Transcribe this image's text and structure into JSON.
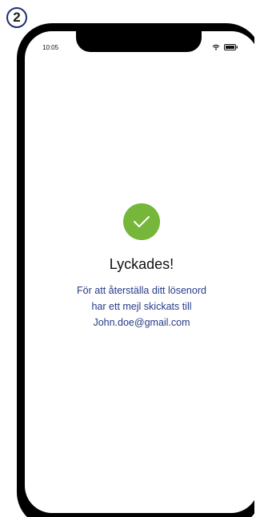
{
  "step": {
    "number": "2"
  },
  "status_bar": {
    "time": "10:05",
    "icons": [
      "wifi-icon",
      "battery-icon"
    ]
  },
  "success": {
    "icon": "check-icon",
    "title": "Lyckades!",
    "message_lines": [
      "För att återställa ditt lösenord",
      "har ett mejl skickats till",
      "John.doe@gmail.com"
    ]
  },
  "colors": {
    "frame": "#000000",
    "success_green": "#76b63a",
    "message_blue": "#253b8a",
    "badge_border": "#1f2f6e"
  }
}
